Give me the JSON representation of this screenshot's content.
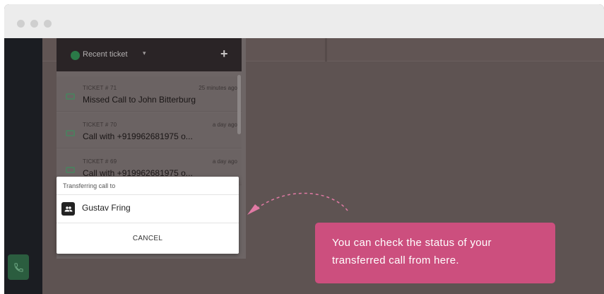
{
  "recent_ticket": {
    "label": "Recent ticket",
    "caret": "▾",
    "add": "+"
  },
  "tickets": [
    {
      "number": "TICKET # 71",
      "time": "25 minutes ago",
      "title": "Missed Call to John Bitterburg"
    },
    {
      "number": "TICKET # 70",
      "time": "a day ago",
      "title": "Call with +919962681975 o..."
    },
    {
      "number": "TICKET # 69",
      "time": "a day ago",
      "title": "Call with +919962681975 o..."
    }
  ],
  "transfer": {
    "title": "Transferring call to",
    "contact_name": "Gustav Fring",
    "cancel_label": "CANCEL"
  },
  "tooltip": {
    "text": "You can check the status of your transferred call from here."
  },
  "colors": {
    "tooltip_bg": "#cc4f7e",
    "call_button": "#2b5d3f",
    "sidebar": "#1b1d22",
    "overlay": "#5e5352"
  }
}
